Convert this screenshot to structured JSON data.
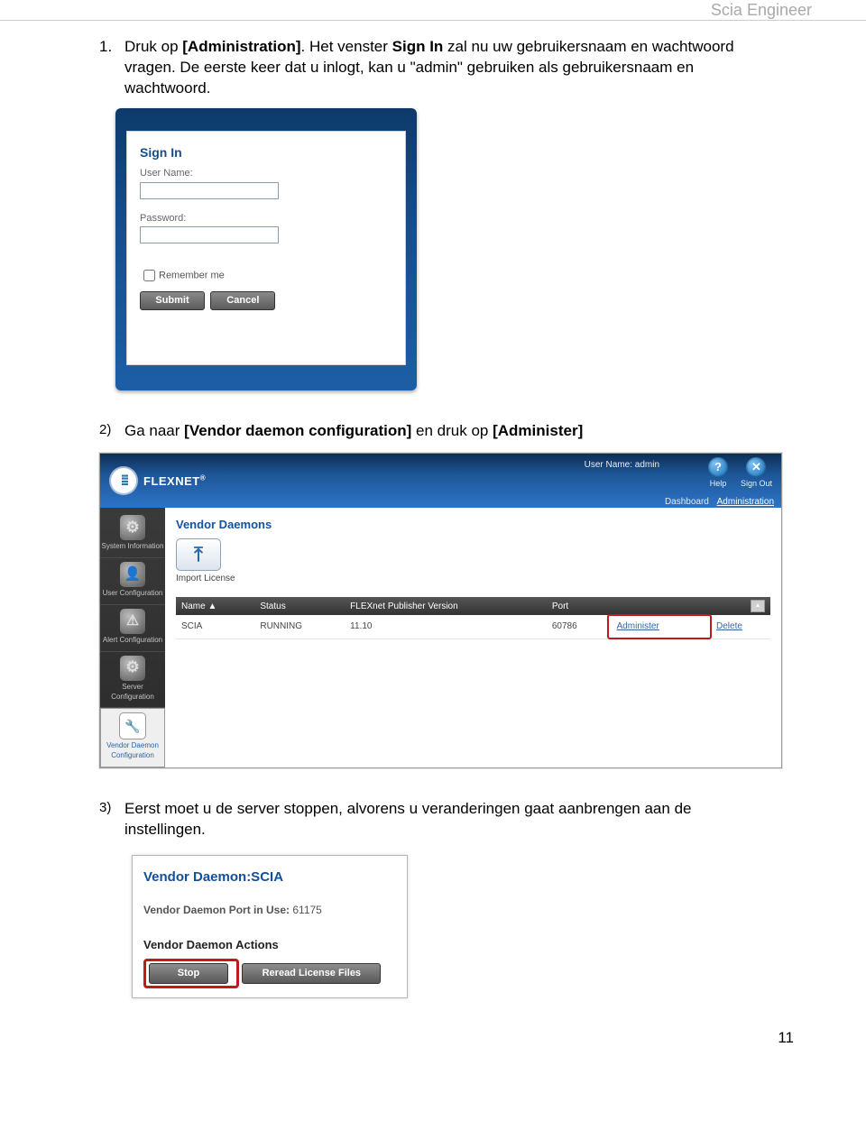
{
  "header": {
    "product": "Scia Engineer"
  },
  "step1": {
    "num": "1.",
    "t1": "Druk op ",
    "b1": "[Administration]",
    "t2": ". Het venster ",
    "b2": "Sign In",
    "t3": " zal nu uw gebruikersnaam en wachtwoord vragen. De eerste keer dat u inlogt, kan u \"admin\" gebruiken als gebruikersnaam en wachtwoord."
  },
  "signin": {
    "title": "Sign In",
    "user_label": "User Name:",
    "pass_label": "Password:",
    "remember": "Remember me",
    "submit": "Submit",
    "cancel": "Cancel"
  },
  "step2": {
    "num": "2)",
    "t1": "Ga naar ",
    "b1": "[Vendor daemon configuration]",
    "t2": " en druk op ",
    "b2": "[Administer]"
  },
  "flex": {
    "brand": "FLEXNET",
    "brand_sup": "®",
    "user_label": "User Name: admin",
    "help": "Help",
    "signout": "Sign Out",
    "tab_dash": "Dashboard",
    "tab_admin": "Administration",
    "side": {
      "sys": "System Information",
      "user": "User Configuration",
      "alert": "Alert Configuration",
      "server": "Server Configuration",
      "vdc": "Vendor Daemon Configuration"
    },
    "vd_title": "Vendor Daemons",
    "import": "Import License",
    "cols": {
      "name": "Name ▲",
      "status": "Status",
      "ver": "FLEXnet Publisher Version",
      "port": "Port"
    },
    "row": {
      "name": "SCIA",
      "status": "RUNNING",
      "ver": "11.10",
      "port": "60786",
      "admin": "Administer",
      "delete": "Delete"
    }
  },
  "step3": {
    "num": "3)",
    "text": "Eerst moet u de server stoppen, alvorens u veranderingen gaat aanbrengen aan de instellingen."
  },
  "vdscia": {
    "title": "Vendor Daemon:SCIA",
    "port_label": "Vendor Daemon Port in Use:",
    "port_value": "61175",
    "actions": "Vendor Daemon Actions",
    "stop": "Stop",
    "reread": "Reread License Files"
  },
  "page_number": "11"
}
